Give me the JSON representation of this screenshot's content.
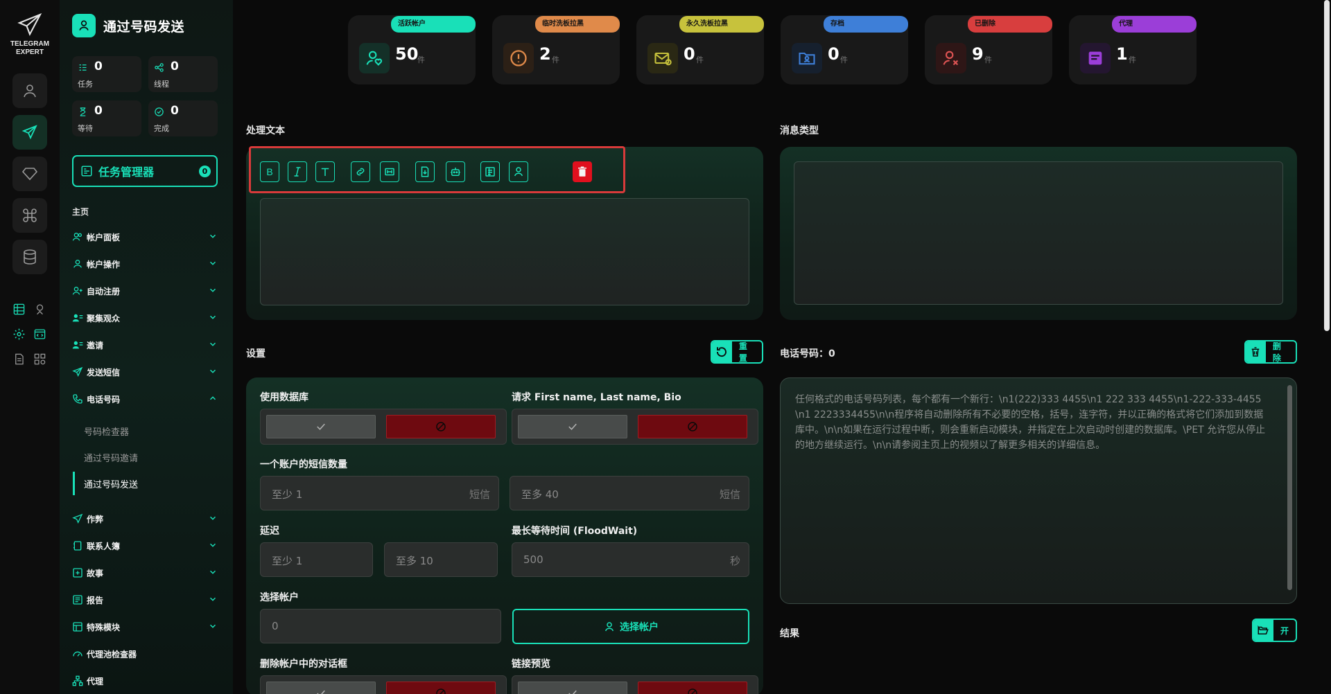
{
  "brand": {
    "line1": "TELEGRAM",
    "line2": "EXPERT"
  },
  "sidebar": {
    "title": "通过号码发送",
    "stats": [
      {
        "value": "0",
        "label": "任务"
      },
      {
        "value": "0",
        "label": "线程"
      },
      {
        "value": "0",
        "label": "等待"
      },
      {
        "value": "0",
        "label": "完成"
      }
    ],
    "task_manager": {
      "label": "任务管理器",
      "badge": "0"
    },
    "home": "主页",
    "nav": [
      {
        "label": "帐户面板"
      },
      {
        "label": "帐户操作"
      },
      {
        "label": "自动注册"
      },
      {
        "label": "聚集观众"
      },
      {
        "label": "邀请"
      },
      {
        "label": "发送短信"
      },
      {
        "label": "电话号码"
      },
      {
        "label": "作弊"
      },
      {
        "label": "联系人簿"
      },
      {
        "label": "故事"
      },
      {
        "label": "报告"
      },
      {
        "label": "特殊模块"
      },
      {
        "label": "代理池检查器"
      },
      {
        "label": "代理"
      }
    ],
    "sub_items": [
      {
        "label": "号码检查器"
      },
      {
        "label": "通过号码邀请"
      },
      {
        "label": "通过号码发送"
      }
    ]
  },
  "stat_cards": [
    {
      "label": "活跃帐户",
      "value": "50",
      "unit": "件",
      "color": "#19e0b8"
    },
    {
      "label": "临时洗板拉黑",
      "value": "2",
      "unit": "件",
      "color": "#e08a4a"
    },
    {
      "label": "永久洗板拉黑",
      "value": "0",
      "unit": "件",
      "color": "#c7c23c"
    },
    {
      "label": "存档",
      "value": "0",
      "unit": "件",
      "color": "#3e7fd8"
    },
    {
      "label": "已删除",
      "value": "9",
      "unit": "件",
      "color": "#d83e3e"
    },
    {
      "label": "代理",
      "value": "1",
      "unit": "件",
      "color": "#9b3ed8"
    }
  ],
  "main": {
    "process_text_label": "处理文本",
    "message_type_label": "消息类型",
    "settings_label": "设置",
    "reset_label": "重置",
    "phone_label": "电话号码：0",
    "delete_label": "删除",
    "result_label": "结果",
    "open_label": "开",
    "use_db_label": "使用数据库",
    "request_label": "请求 First name, Last name, Bio",
    "sms_count_label": "一个账户的短信数量",
    "sms_min": "至少  1",
    "sms_max": "至多  40",
    "sms_unit": "短信",
    "delay_label": "延迟",
    "delay_min": "至少  1",
    "delay_max": "至多  10",
    "flood_label": "最长等待时间 (FloodWait)",
    "flood_value": "500",
    "flood_unit": "秒",
    "select_account_label": "选择帐户",
    "select_account_value": "0",
    "select_account_button": "选择帐户",
    "delete_dialogs_label": "删除帐户中的对话框",
    "link_preview_label": "链接预览",
    "phone_placeholder": "任何格式的电话号码列表，每个都有一个新行：\\n1(222)333 4455\\n1 222 333 4455\\n1-222-333-4455 \\n1 2223334455\\n\\n程序将自动删除所有不必要的空格，括号，连字符，并以正确的格式将它们添加到数据库中。\\n\\n如果在运行过程中断，则会重新启动模块，并指定在上次启动时创建的数据库。\\PET 允许您从停止的地方继续运行。\\n\\n请参阅主页上的视频以了解更多相关的详细信息。"
  }
}
